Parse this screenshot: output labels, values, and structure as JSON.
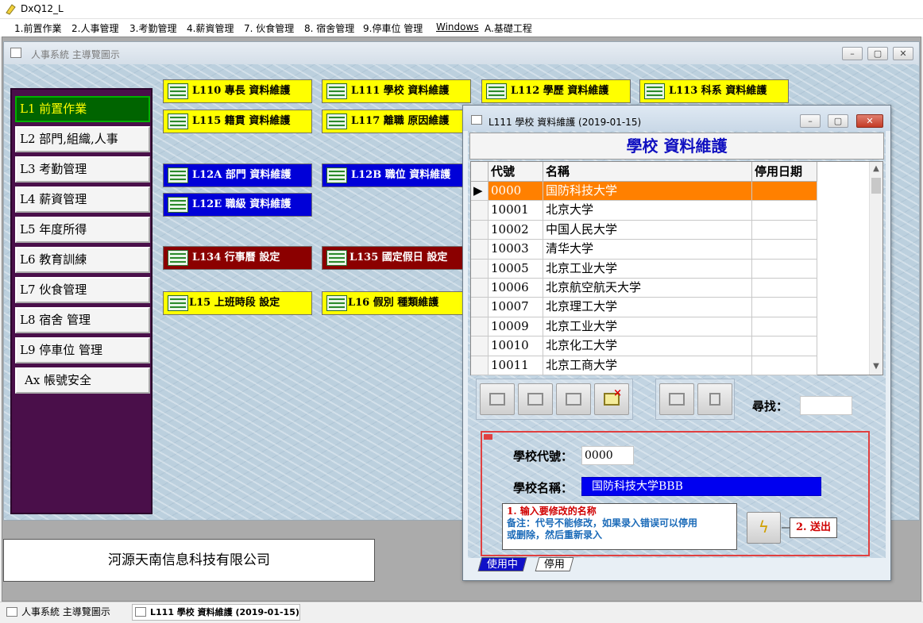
{
  "app": {
    "title": "DxQ12_L"
  },
  "menu": [
    "1.前置作業",
    "2.人事管理",
    "3.考勤管理",
    "4.薪資管理",
    "7. 伙食管理",
    "8. 宿舍管理",
    "9.停車位 管理",
    "Windows",
    "A.基礎工程"
  ],
  "child": {
    "title": "人事系統 主導覽圖示"
  },
  "leftnav": [
    {
      "label": "L1 前置作業",
      "active": true
    },
    {
      "label": "L2 部門,組織,人事"
    },
    {
      "label": "L3 考勤管理"
    },
    {
      "label": "L4 薪資管理"
    },
    {
      "label": "L5 年度所得"
    },
    {
      "label": "L6 教育訓練"
    },
    {
      "label": "L7 伙食管理"
    },
    {
      "label": "L8 宿舍 管理"
    },
    {
      "label": "L9 停車位 管理"
    },
    {
      "label": "Ax 帳號安全"
    }
  ],
  "modules": {
    "l110": "L110 專長 資料維護",
    "l111": "L111 學校 資料維護",
    "l112": "L112 學歷 資料維護",
    "l113": "L113 科系 資料維護",
    "l115": "L115 籍貫 資料維護",
    "l117": "L117 離職 原因維護",
    "l12a": "L12A 部門 資料維護",
    "l12b": "L12B 職位 資料維護",
    "l12e": "L12E 職級 資料維護",
    "l134": "L134 行事曆 設定",
    "l135": "L135 國定假日 設定",
    "l15": "L15 上班時段 設定",
    "l16": "L16 假別 種類維護"
  },
  "company": "河源天南信息科技有限公司",
  "taskbar": [
    {
      "label": "人事系統 主導覽圖示"
    },
    {
      "label": "L111 學校 資料維護 (2019-01-15)",
      "active": true
    }
  ],
  "dialog": {
    "title": "L111 學校 資料維護 (2019-01-15)",
    "heading": "學校 資料維護",
    "grid": {
      "columns": [
        "代號",
        "名稱",
        "停用日期"
      ],
      "rows": [
        {
          "code": "0000",
          "name": "国防科技大学",
          "date": "",
          "selected": true,
          "marker": "▶"
        },
        {
          "code": "10001",
          "name": "北京大学",
          "date": ""
        },
        {
          "code": "10002",
          "name": "中国人民大学",
          "date": ""
        },
        {
          "code": "10003",
          "name": "清华大学",
          "date": ""
        },
        {
          "code": "10005",
          "name": "北京工业大学",
          "date": ""
        },
        {
          "code": "10006",
          "name": "北京航空航天大学",
          "date": ""
        },
        {
          "code": "10007",
          "name": "北京理工大学",
          "date": ""
        },
        {
          "code": "10009",
          "name": "北京工业大学",
          "date": ""
        },
        {
          "code": "10010",
          "name": "北京化工大学",
          "date": ""
        },
        {
          "code": "10011",
          "name": "北京工商大学",
          "date": ""
        }
      ]
    },
    "search_label": "尋找：",
    "form": {
      "code_label": "學校代號：",
      "code_value": "0000",
      "name_label": "學校名稱：",
      "name_value": "国防科技大学BBB"
    },
    "tip": {
      "line1": "1. 输入要修改的名称",
      "line2": "备注：代号不能修改，如果录入错误可以停用",
      "line3": "或删除，然后重新录入"
    },
    "send_label": "2. 送出",
    "tabs": [
      {
        "label": "使用中",
        "active": true
      },
      {
        "label": "停用"
      }
    ]
  }
}
